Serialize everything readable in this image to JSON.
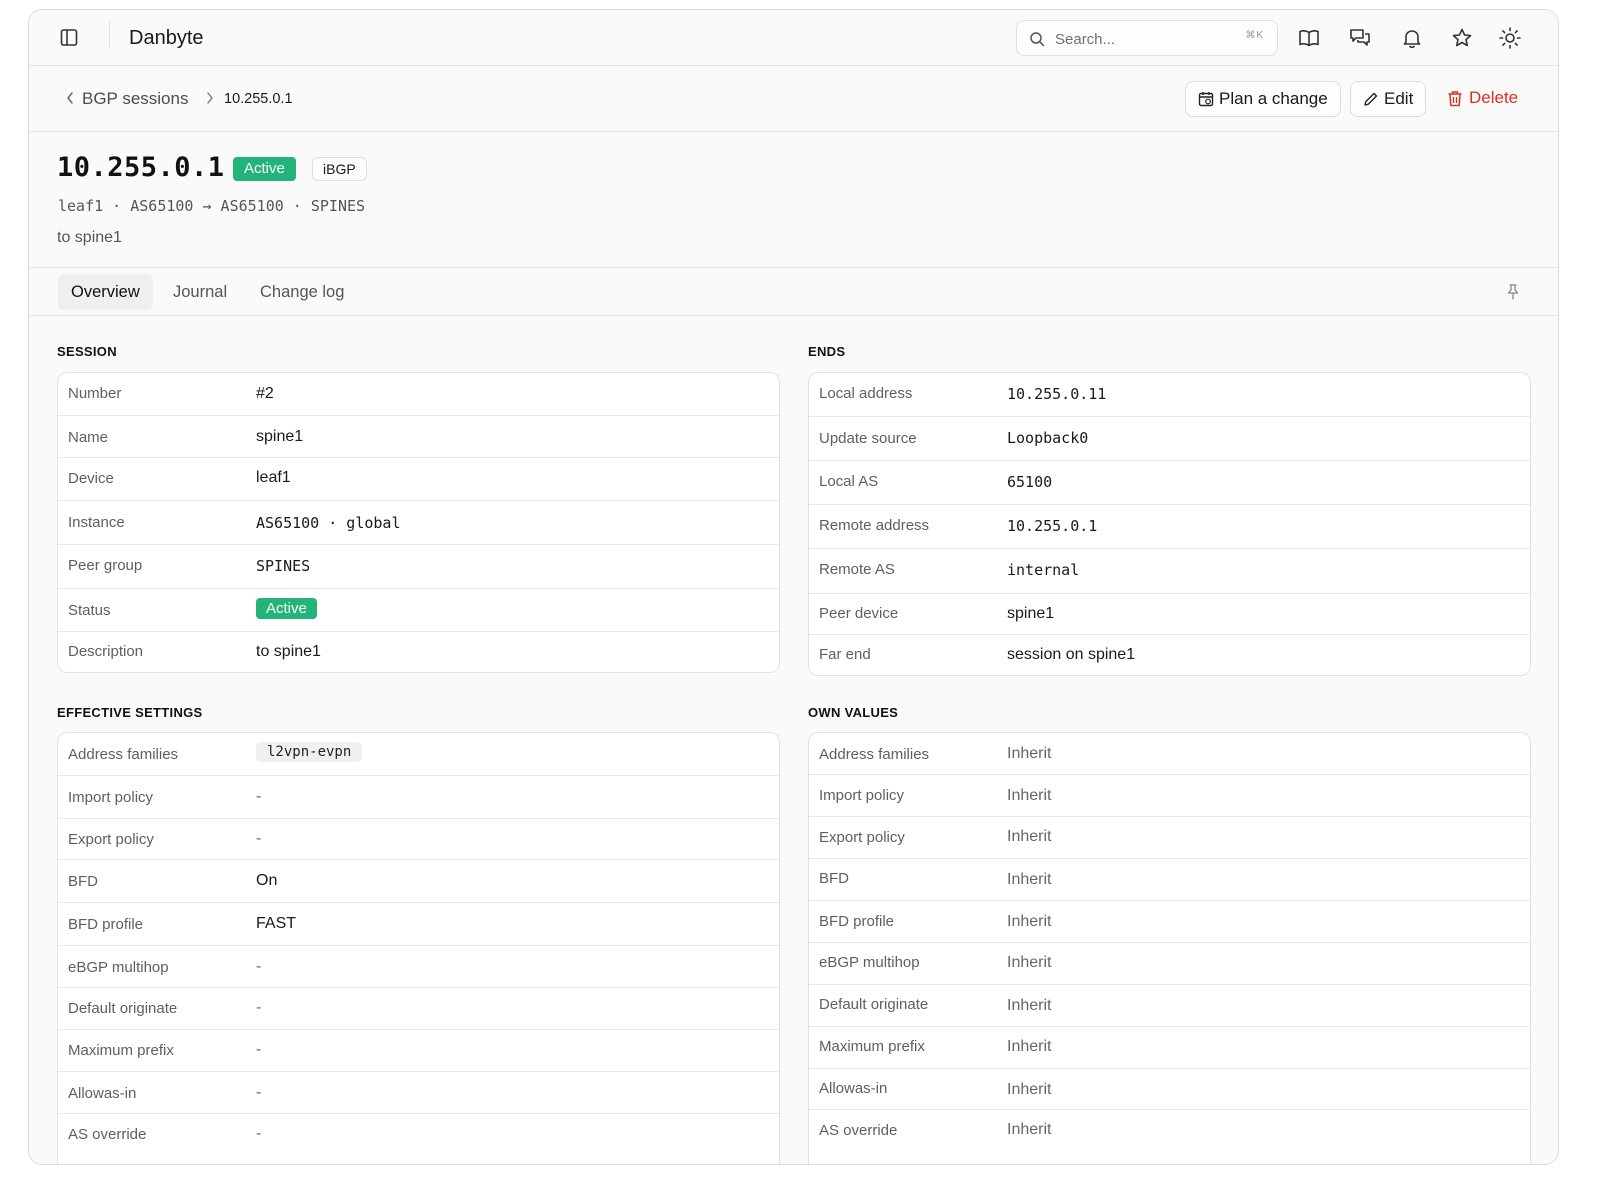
{
  "app": {
    "title": "Danbyte",
    "search_placeholder": "Search...",
    "search_shortcut": "⌘K"
  },
  "breadcrumb": {
    "parent": "BGP sessions",
    "current": "10.255.0.1"
  },
  "actions": {
    "plan": "Plan a change",
    "edit": "Edit",
    "delete": "Delete"
  },
  "header": {
    "title": "10.255.0.1",
    "status": "Active",
    "type": "iBGP",
    "subline": "leaf1 · AS65100 → AS65100 · SPINES",
    "description": "to spine1"
  },
  "tabs": [
    {
      "label": "Overview",
      "active": true
    },
    {
      "label": "Journal",
      "active": false
    },
    {
      "label": "Change log",
      "active": false
    }
  ],
  "session": {
    "title": "SESSION",
    "rows": [
      {
        "label": "Number",
        "value": "#2"
      },
      {
        "label": "Name",
        "value": "spine1"
      },
      {
        "label": "Device",
        "value": "leaf1"
      },
      {
        "label": "Instance",
        "value": "AS65100 · global"
      },
      {
        "label": "Peer group",
        "value": "SPINES"
      },
      {
        "label": "Status",
        "value": "Active"
      },
      {
        "label": "Description",
        "value": "to spine1"
      }
    ]
  },
  "ends": {
    "title": "ENDS",
    "rows": [
      {
        "label": "Local address",
        "value": "10.255.0.11"
      },
      {
        "label": "Update source",
        "value": "Loopback0"
      },
      {
        "label": "Local AS",
        "value": "65100"
      },
      {
        "label": "Remote address",
        "value": "10.255.0.1"
      },
      {
        "label": "Remote AS",
        "value": "internal"
      },
      {
        "label": "Peer device",
        "value": "spine1"
      },
      {
        "label": "Far end",
        "value": "session on spine1"
      }
    ]
  },
  "effective": {
    "title": "EFFECTIVE SETTINGS",
    "rows": [
      {
        "label": "Address families",
        "value": "l2vpn-evpn"
      },
      {
        "label": "Import policy",
        "value": "-"
      },
      {
        "label": "Export policy",
        "value": "-"
      },
      {
        "label": "BFD",
        "value": "On"
      },
      {
        "label": "BFD profile",
        "value": "FAST"
      },
      {
        "label": "eBGP multihop",
        "value": "-"
      },
      {
        "label": "Default originate",
        "value": "-"
      },
      {
        "label": "Maximum prefix",
        "value": "-"
      },
      {
        "label": "Allowas-in",
        "value": "-"
      },
      {
        "label": "AS override",
        "value": "-"
      }
    ]
  },
  "own": {
    "title": "OWN VALUES",
    "rows": [
      {
        "label": "Address families",
        "value": "Inherit"
      },
      {
        "label": "Import policy",
        "value": "Inherit"
      },
      {
        "label": "Export policy",
        "value": "Inherit"
      },
      {
        "label": "BFD",
        "value": "Inherit"
      },
      {
        "label": "BFD profile",
        "value": "Inherit"
      },
      {
        "label": "eBGP multihop",
        "value": "Inherit"
      },
      {
        "label": "Default originate",
        "value": "Inherit"
      },
      {
        "label": "Maximum prefix",
        "value": "Inherit"
      },
      {
        "label": "Allowas-in",
        "value": "Inherit"
      },
      {
        "label": "AS override",
        "value": "Inherit"
      }
    ]
  },
  "colors": {
    "accent_active": "#22b47a",
    "danger": "#d93025"
  },
  "icons": [
    "sidebar-toggle-icon",
    "search-icon",
    "book-icon",
    "chat-icon",
    "bell-icon",
    "star-icon",
    "sun-icon",
    "chevron-left-icon",
    "chevron-right-icon",
    "calendar-icon",
    "pencil-icon",
    "trash-icon",
    "pin-icon"
  ]
}
